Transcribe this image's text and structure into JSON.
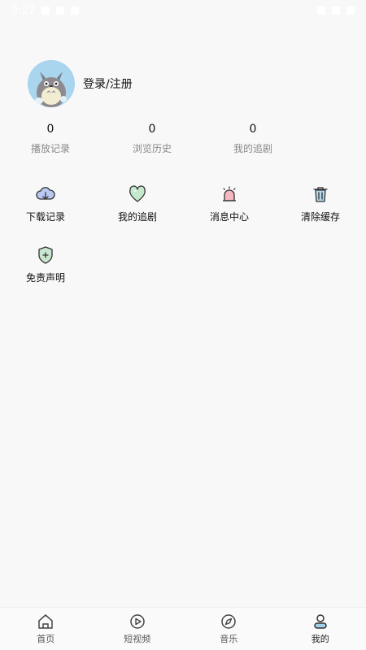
{
  "statusbar": {
    "time": "9:27"
  },
  "profile": {
    "login_label": "登录/注册"
  },
  "stats": [
    {
      "value": "0",
      "label": "播放记录"
    },
    {
      "value": "0",
      "label": "浏览历史"
    },
    {
      "value": "0",
      "label": "我的追剧"
    }
  ],
  "grid": [
    {
      "label": "下载记录",
      "icon": "cloud-download-icon"
    },
    {
      "label": "我的追剧",
      "icon": "heart-icon"
    },
    {
      "label": "消息中心",
      "icon": "alarm-bell-icon"
    },
    {
      "label": "清除缓存",
      "icon": "trash-icon"
    },
    {
      "label": "免责声明",
      "icon": "shield-plus-icon"
    }
  ],
  "tabbar": {
    "items": [
      {
        "label": "首页",
        "icon": "home-icon"
      },
      {
        "label": "短视频",
        "icon": "play-circle-icon"
      },
      {
        "label": "音乐",
        "icon": "compass-icon"
      },
      {
        "label": "我的",
        "icon": "user-icon"
      }
    ],
    "active_index": 3
  }
}
